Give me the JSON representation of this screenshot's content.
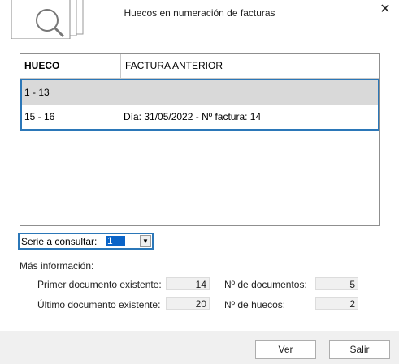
{
  "window": {
    "title": "Huecos en numeración de facturas",
    "close_icon": "close-icon"
  },
  "table": {
    "columns": [
      "HUECO",
      "FACTURA ANTERIOR"
    ],
    "rows": [
      {
        "hueco": "1 - 13",
        "factura": ""
      },
      {
        "hueco": "15 - 16",
        "factura": "Día: 31/05/2022 - Nº factura: 14"
      }
    ]
  },
  "serie": {
    "label": "Serie a consultar:",
    "value": "1"
  },
  "info": {
    "heading": "Más información:",
    "primer_label": "Primer documento existente:",
    "primer_value": "14",
    "ultimo_label": "Último documento existente:",
    "ultimo_value": "20",
    "ndocs_label": "Nº de documentos:",
    "ndocs_value": "5",
    "nhuecos_label": "Nº de huecos:",
    "nhuecos_value": "2"
  },
  "buttons": {
    "ver": "Ver",
    "salir": "Salir"
  }
}
